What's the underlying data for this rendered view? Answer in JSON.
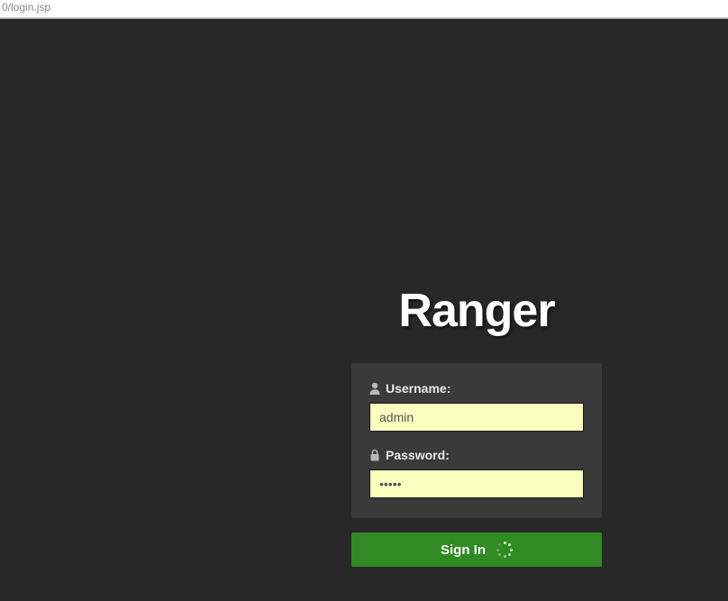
{
  "browser": {
    "url_fragment": "0/login.jsp"
  },
  "brand": {
    "title": "Ranger"
  },
  "form": {
    "username_label": "Username:",
    "username_value": "admin",
    "password_label": "Password:",
    "password_value": "•••••"
  },
  "actions": {
    "signin_label": "Sign In"
  }
}
